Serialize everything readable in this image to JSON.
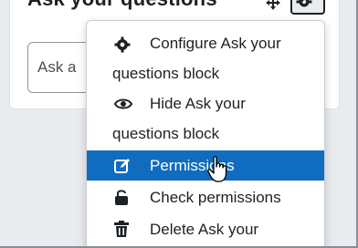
{
  "block": {
    "title": "Ask your questions",
    "input_placeholder": "Ask a"
  },
  "menu": {
    "items": [
      {
        "line1": "Configure Ask your",
        "line2": "questions block",
        "icon": "gear-icon"
      },
      {
        "line1": "Hide Ask your",
        "line2": "questions block",
        "icon": "eye-icon"
      },
      {
        "line1": "Permissions",
        "icon": "edit-icon",
        "active": true
      },
      {
        "line1": "Check permissions",
        "icon": "unlock-icon"
      },
      {
        "line1": "Delete Ask your",
        "icon": "trash-icon"
      }
    ]
  },
  "colors": {
    "accent": "#0f6cbf",
    "menu_bg": "#ffffff",
    "page_bg": "#e9ecef",
    "text": "#1d2125"
  }
}
